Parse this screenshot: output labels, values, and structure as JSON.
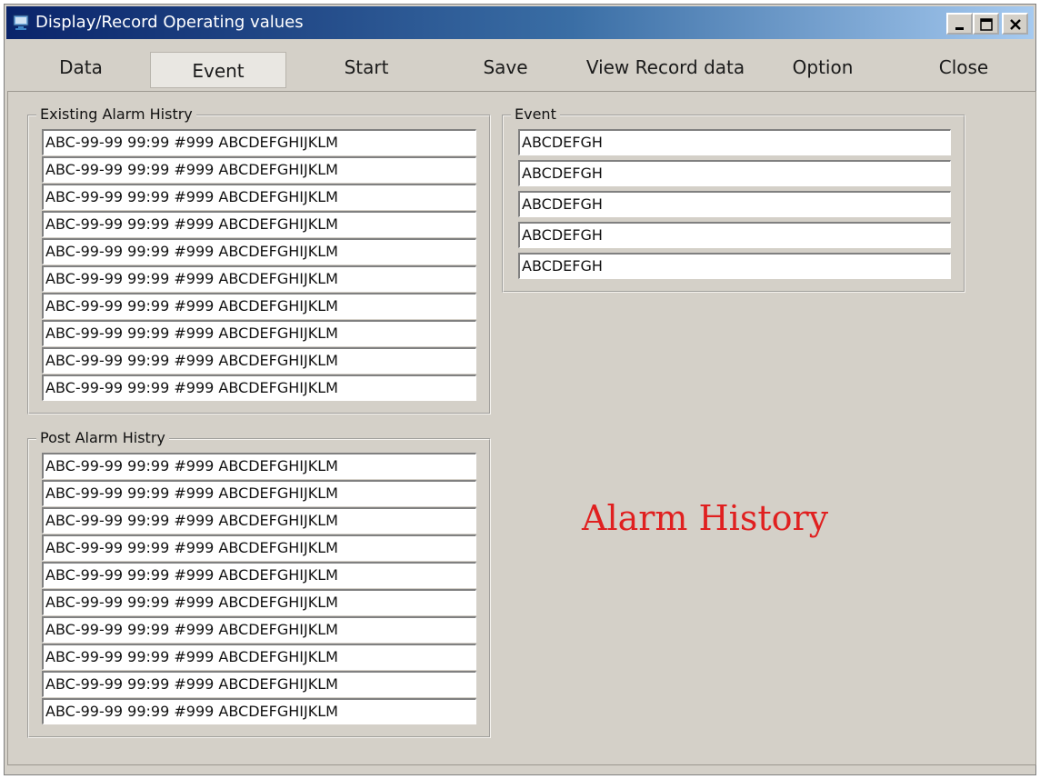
{
  "window": {
    "title": "Display/Record Operating values",
    "title_bar_color": "#0a246a",
    "controls": [
      "minimize-icon",
      "maximize-icon",
      "close-icon"
    ]
  },
  "menu": {
    "items": [
      {
        "label": "Data"
      },
      {
        "label": "Event",
        "active": true
      },
      {
        "label": "Start"
      },
      {
        "label": "Save"
      },
      {
        "label": "View Record data"
      },
      {
        "label": "Option"
      },
      {
        "label": "Close"
      }
    ]
  },
  "existing_alarm": {
    "title": "Existing Alarm Histry",
    "rows": [
      "ABC-99-99 99:99 #999 ABCDEFGHIJKLM",
      "ABC-99-99 99:99 #999 ABCDEFGHIJKLM",
      "ABC-99-99 99:99 #999 ABCDEFGHIJKLM",
      "ABC-99-99 99:99 #999 ABCDEFGHIJKLM",
      "ABC-99-99 99:99 #999 ABCDEFGHIJKLM",
      "ABC-99-99 99:99 #999 ABCDEFGHIJKLM",
      "ABC-99-99 99:99 #999 ABCDEFGHIJKLM",
      "ABC-99-99 99:99 #999 ABCDEFGHIJKLM",
      "ABC-99-99 99:99 #999 ABCDEFGHIJKLM",
      "ABC-99-99 99:99 #999 ABCDEFGHIJKLM"
    ]
  },
  "post_alarm": {
    "title": "Post Alarm Histry",
    "rows": [
      "ABC-99-99 99:99 #999 ABCDEFGHIJKLM",
      "ABC-99-99 99:99 #999 ABCDEFGHIJKLM",
      "ABC-99-99 99:99 #999 ABCDEFGHIJKLM",
      "ABC-99-99 99:99 #999 ABCDEFGHIJKLM",
      "ABC-99-99 99:99 #999 ABCDEFGHIJKLM",
      "ABC-99-99 99:99 #999 ABCDEFGHIJKLM",
      "ABC-99-99 99:99 #999 ABCDEFGHIJKLM",
      "ABC-99-99 99:99 #999 ABCDEFGHIJKLM",
      "ABC-99-99 99:99 #999 ABCDEFGHIJKLM",
      "ABC-99-99 99:99 #999 ABCDEFGHIJKLM"
    ]
  },
  "event": {
    "title": "Event",
    "rows": [
      "ABCDEFGH",
      "ABCDEFGH",
      "ABCDEFGH",
      "ABCDEFGH",
      "ABCDEFGH"
    ]
  },
  "overlay": {
    "text": "Alarm History",
    "color": "#e02020"
  }
}
